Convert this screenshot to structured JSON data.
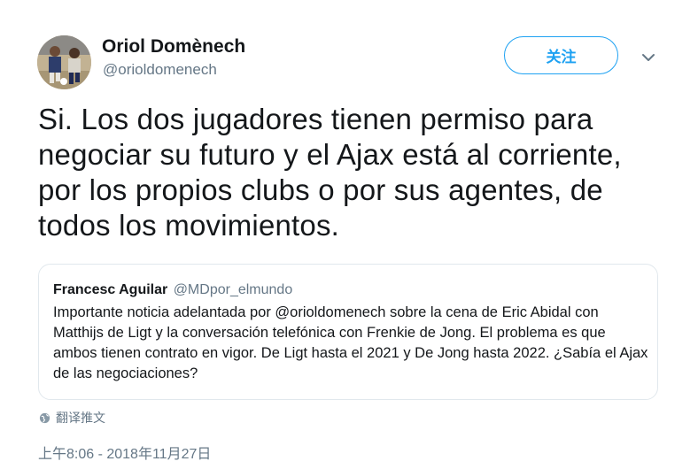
{
  "author": {
    "name": "Oriol Domènech",
    "handle": "@orioldomenech"
  },
  "follow_label": "关注",
  "tweet_text": "Si. Los dos jugadores tienen permiso para negociar su futuro y el Ajax está al corriente, por los propios clubs o por sus agentes, de todos los movimientos.",
  "quoted_tweet": {
    "name": "Francesc Aguilar",
    "handle": "@MDpor_elmundo",
    "text": "Importante noticia adelantada por @orioldomenech sobre la cena de Eric Abidal con Matthijs de Ligt y la conversación telefónica con Frenkie de Jong. El problema es que ambos tienen contrato en vigor. De Ligt hasta el 2021 y De Jong hasta 2022. ¿Sabía el Ajax de las negociaciones?"
  },
  "translate_label": "翻译推文",
  "timestamp": "上午8:06 - 2018年11月27日",
  "icons": {
    "avatar": "avatar-photo",
    "chevron": "chevron-down-icon",
    "translate": "globe-icon"
  },
  "colors": {
    "accent": "#1da1f2",
    "secondary_text": "#657786",
    "border": "#e1e8ed"
  }
}
